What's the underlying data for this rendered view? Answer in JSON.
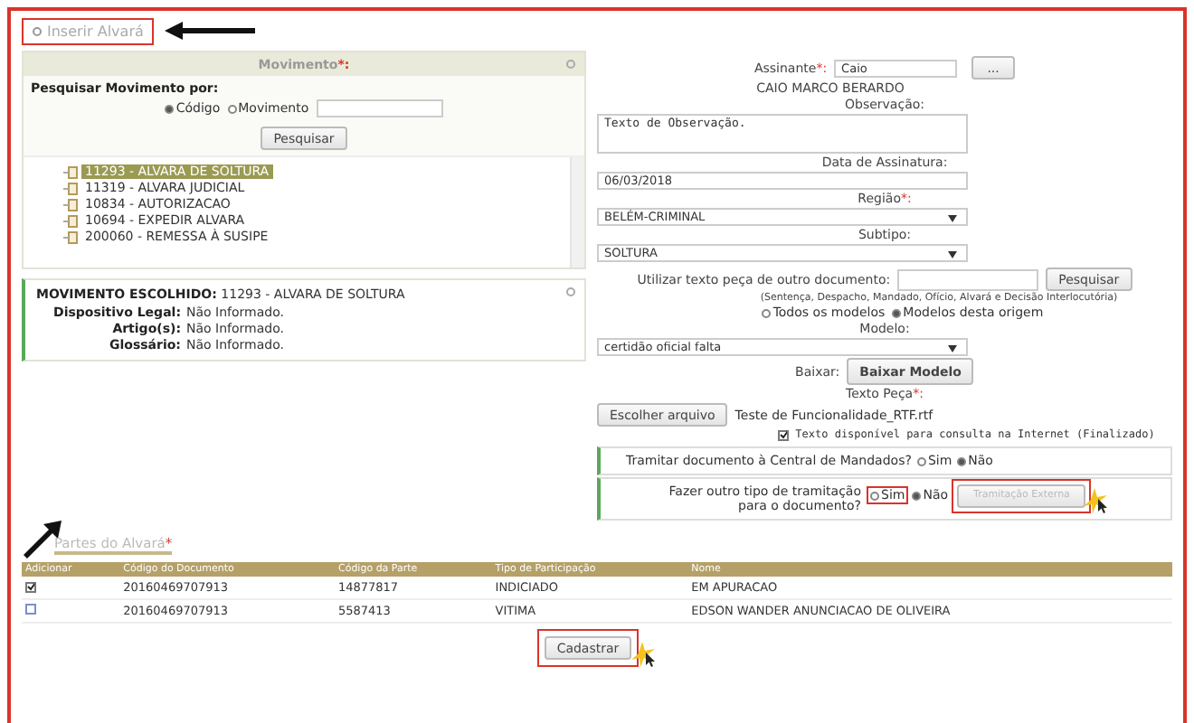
{
  "header_tab": {
    "label": "Inserir Alvará"
  },
  "movimento": {
    "title": "Movimento",
    "required": "*:",
    "search_label": "Pesquisar Movimento por:",
    "radios": [
      {
        "label": "Código",
        "selected": true
      },
      {
        "label": "Movimento",
        "selected": false
      }
    ],
    "search_button": "Pesquisar",
    "tree": [
      {
        "label": "11293 - ALVARA DE SOLTURA",
        "selected": true
      },
      {
        "label": "11319 - ALVARA JUDICIAL",
        "selected": false
      },
      {
        "label": "10834 - AUTORIZACAO",
        "selected": false
      },
      {
        "label": "10694 - EXPEDIR ALVARA",
        "selected": false
      },
      {
        "label": "200060 - REMESSA À SUSIPE",
        "selected": false
      }
    ]
  },
  "chosen": {
    "label": "MOVIMENTO ESCOLHIDO:",
    "value": "11293 - ALVARA DE SOLTURA",
    "fields": [
      {
        "label": "Dispositivo Legal:",
        "value": "Não Informado."
      },
      {
        "label": "Artigo(s):",
        "value": "Não Informado."
      },
      {
        "label": "Glossário:",
        "value": "Não Informado."
      }
    ]
  },
  "form": {
    "assinante": {
      "label": "Assinante",
      "required": "*:",
      "value": "Caio",
      "button": "..."
    },
    "signer_name": "CAIO MARCO BERARDO",
    "observacao": {
      "label": "Observação:",
      "value": "Texto de Observação."
    },
    "data": {
      "label": "Data de Assinatura:",
      "value": "06/03/2018"
    },
    "regiao": {
      "label": "Região",
      "required": "*:",
      "value": "BELÉM-CRIMINAL"
    },
    "subtipo": {
      "label": "Subtipo:",
      "value": "SOLTURA"
    },
    "outro": {
      "label": "Utilizar texto peça de outro documento:",
      "button": "Pesquisar",
      "hint": "(Sentença, Despacho, Mandado, Ofício, Alvará e Decisão Interlocutória)"
    },
    "model_radios": [
      {
        "label": "Todos os modelos",
        "selected": false
      },
      {
        "label": "Modelos desta origem",
        "selected": true
      }
    ],
    "modelo": {
      "label": "Modelo:",
      "value": "certidão oficial falta"
    },
    "baixar": {
      "label": "Baixar:",
      "button": "Baixar Modelo"
    },
    "texto_peca": {
      "label": "Texto Peça",
      "required": "*:",
      "button": "Escolher arquivo",
      "file": "Teste de Funcionalidade_RTF.rtf"
    },
    "internet": {
      "label": "Texto disponível para consulta na Internet (Finalizado)",
      "checked": true
    },
    "tramitar": {
      "question": "Tramitar documento à Central de Mandados?",
      "options": [
        {
          "label": "Sim",
          "selected": false
        },
        {
          "label": "Não",
          "selected": true
        }
      ]
    },
    "outro_tipo": {
      "question": "Fazer outro tipo de tramitação para o documento?",
      "options": [
        {
          "label": "Sim",
          "selected": false
        },
        {
          "label": "Não",
          "selected": true
        }
      ],
      "button": "Tramitação Externa",
      "disabled": true
    }
  },
  "partes": {
    "tab": "Partes do Alvará",
    "required": "*",
    "columns": [
      "Adicionar",
      "Código do Documento",
      "Código da Parte",
      "Tipo de Participação",
      "Nome"
    ],
    "rows": [
      {
        "checked": true,
        "cells": [
          "",
          "20160469707913",
          "14877817",
          "INDICIADO",
          "EM APURACAO"
        ]
      },
      {
        "checked": false,
        "cells": [
          "",
          "20160469707913",
          "5587413",
          "VITIMA",
          "EDSON WANDER ANUNCIACAO DE OLIVEIRA"
        ]
      }
    ],
    "button": "Cadastrar"
  }
}
